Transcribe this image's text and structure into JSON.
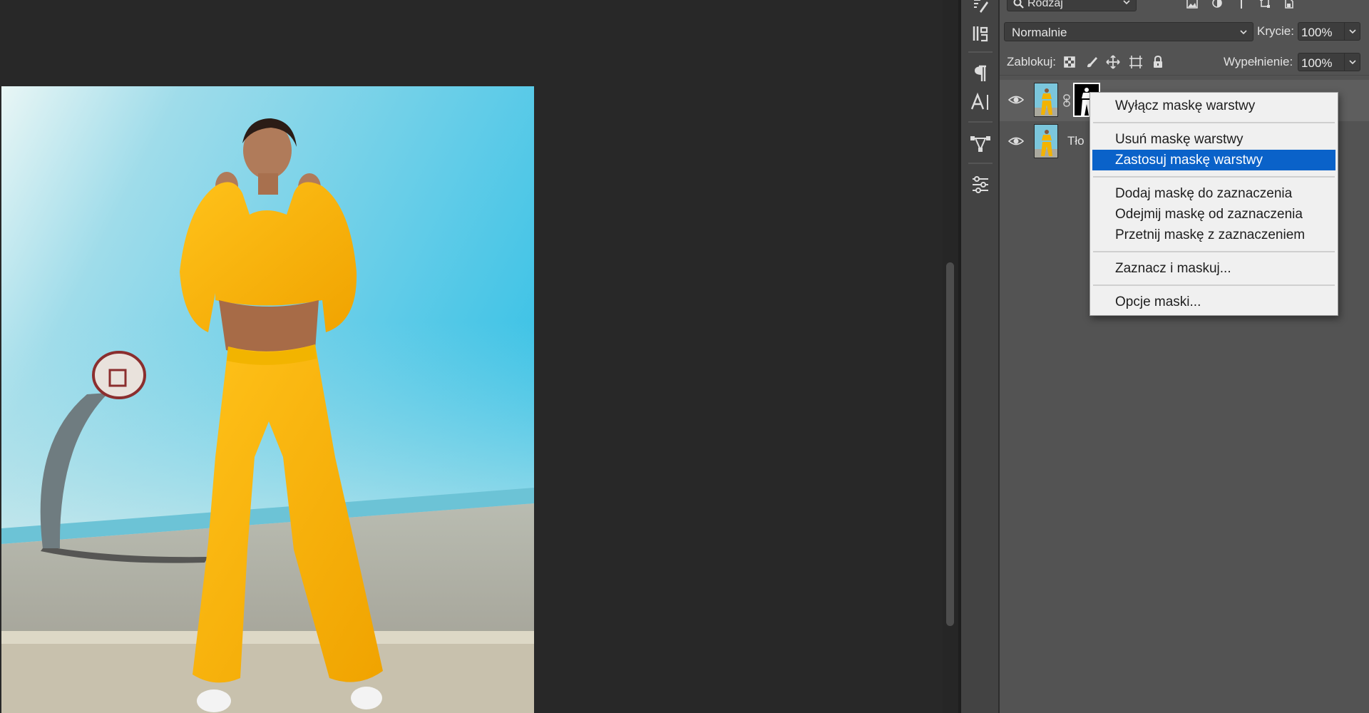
{
  "layers_panel": {
    "filter_label": "Rodzaj",
    "blend_mode": "Normalnie",
    "opacity_label": "Krycie:",
    "opacity_value": "100%",
    "lock_label": "Zablokuj:",
    "fill_label": "Wypełnienie:",
    "fill_value": "100%",
    "layers": [
      {
        "name": "",
        "visible": true,
        "has_mask": true
      },
      {
        "name": "Tło",
        "visible": true,
        "has_mask": false
      }
    ]
  },
  "context_menu": {
    "items": [
      {
        "label": "Wyłącz maskę warstwy",
        "selected": false
      },
      {
        "label": "Usuń maskę warstwy",
        "selected": false
      },
      {
        "label": "Zastosuj maskę warstwy",
        "selected": true
      },
      {
        "label": "Dodaj maskę do zaznaczenia",
        "selected": false
      },
      {
        "label": "Odejmij maskę od zaznaczenia",
        "selected": false
      },
      {
        "label": "Przetnij maskę z zaznaczeniem",
        "selected": false
      },
      {
        "label": "Zaznacz i maskuj...",
        "selected": false
      },
      {
        "label": "Opcje maski...",
        "selected": false
      }
    ]
  },
  "tools": [
    "brush-settings-icon",
    "clone-source-icon",
    "paragraph-icon",
    "character-icon",
    "paths-icon",
    "adjustments-icon"
  ],
  "colors": {
    "accent": "#0a62c9",
    "panel": "#535353",
    "canvas": "#282828",
    "menu": "#f0f0f0"
  }
}
